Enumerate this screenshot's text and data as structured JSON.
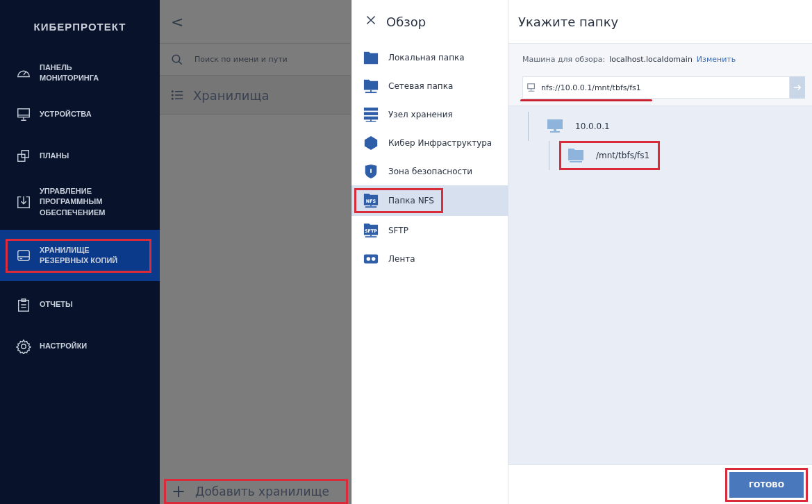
{
  "sidebar": {
    "logo": "КИБЕРПРОТЕКТ",
    "items": [
      {
        "label": "ПАНЕЛЬ МОНИТОРИНГА",
        "selected": false,
        "highlighted": false
      },
      {
        "label": "УСТРОЙСТВА",
        "selected": false,
        "highlighted": false
      },
      {
        "label": "ПЛАНЫ",
        "selected": false,
        "highlighted": false
      },
      {
        "label": "УПРАВЛЕНИЕ ПРОГРАММНЫМ ОБЕСПЕЧЕНИЕМ",
        "selected": false,
        "highlighted": false
      },
      {
        "label": "ХРАНИЛИЩЕ РЕЗЕРВНЫХ КОПИЙ",
        "selected": true,
        "highlighted": true
      },
      {
        "label": "ОТЧЕТЫ",
        "selected": false,
        "highlighted": false
      },
      {
        "label": "НАСТРОЙКИ",
        "selected": false,
        "highlighted": false
      }
    ]
  },
  "storage_panel": {
    "back": "<",
    "search": {
      "placeholder": "Поиск по имени и пути"
    },
    "heading": "Хранилища",
    "add_button": {
      "icon": "+",
      "label": "Добавить хранилище",
      "highlighted": true
    }
  },
  "browse": {
    "title": "Обзор",
    "items": [
      {
        "label": "Локальная папка",
        "selected": false,
        "highlighted": false
      },
      {
        "label": "Сетевая папка",
        "selected": false,
        "highlighted": false
      },
      {
        "label": "Узел хранения",
        "selected": false,
        "highlighted": false
      },
      {
        "label": "Кибер Инфраструктура",
        "selected": false,
        "highlighted": false
      },
      {
        "label": "Зона безопасности",
        "selected": false,
        "highlighted": false
      },
      {
        "label": "Папка NFS",
        "icon_label": "NFS",
        "selected": true,
        "highlighted": true
      },
      {
        "label": "SFTP",
        "icon_label": "SFTP",
        "selected": false,
        "highlighted": false
      },
      {
        "label": "Лента",
        "selected": false,
        "highlighted": false
      }
    ]
  },
  "folder_picker": {
    "title": "Укажите папку",
    "machine_label": "Машина для обзора:",
    "machine": "localhost.localdomain",
    "change_link": "Изменить",
    "path_field": {
      "value": "nfs://10.0.0.1/mnt/tbfs/fs1",
      "highlighted": true
    },
    "tree": [
      {
        "label": "10.0.0.1",
        "kind": "computer",
        "highlighted": false,
        "children": [
          {
            "label": "/mnt/tbfs/fs1",
            "kind": "folder",
            "highlighted": true
          }
        ]
      }
    ],
    "done_button": {
      "label": "ГОТОВО",
      "highlighted": true
    }
  }
}
